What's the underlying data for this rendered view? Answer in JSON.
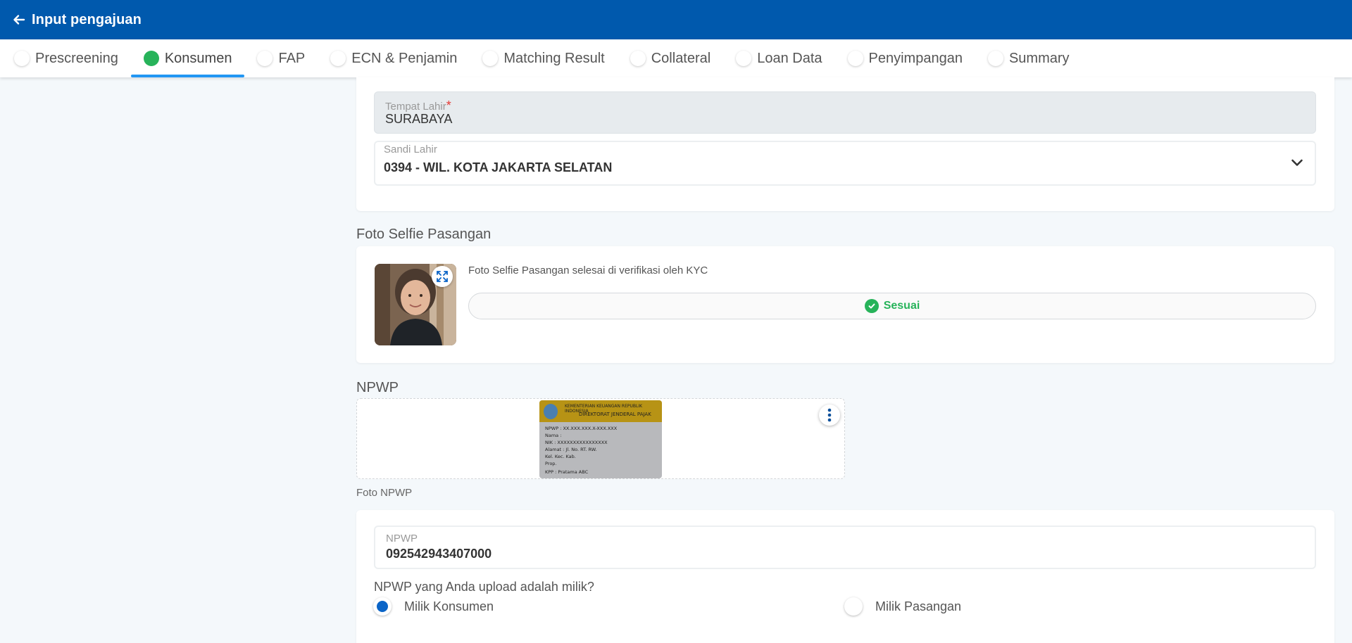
{
  "header": {
    "title": "Input pengajuan",
    "background": "#0059ad"
  },
  "tabs": [
    {
      "label": "Prescreening",
      "active": false
    },
    {
      "label": "Konsumen",
      "active": true
    },
    {
      "label": "FAP",
      "active": false
    },
    {
      "label": "ECN & Penjamin",
      "active": false
    },
    {
      "label": "Matching Result",
      "active": false
    },
    {
      "label": "Collateral",
      "active": false
    },
    {
      "label": "Loan Data",
      "active": false
    },
    {
      "label": "Penyimpangan",
      "active": false
    },
    {
      "label": "Summary",
      "active": false
    }
  ],
  "birth": {
    "tempat_lahir_label": "Tempat Lahir",
    "required_mark": "*",
    "tempat_lahir_value": "SURABAYA",
    "sandi_lahir_label": "Sandi Lahir",
    "sandi_lahir_value": "0394 - WIL. KOTA JAKARTA SELATAN"
  },
  "selfie": {
    "section_title": "Foto Selfie Pasangan",
    "caption": "Foto Selfie Pasangan selesai di verifikasi oleh KYC",
    "status": "Sesuai",
    "status_color": "#27b35a"
  },
  "npwp_upload": {
    "section_title": "NPWP",
    "caption": "Foto NPWP",
    "card": {
      "header_line1": "KEMENTERIAN KEUANGAN REPUBLIK INDONESIA",
      "header_line2": "DIREKTORAT JENDERAL PAJAK",
      "npwp": "NPWP :   XX.XXX.XXX.X-XXX.XXX",
      "nama": "Nama :",
      "nik": "NIK    : XXXXXXXXXXXXXXXX",
      "alamat": "Alamat : Jl.                No.      RT.   RW.",
      "kel": "Kel.                    Kec.               Kab.",
      "prop": "Prop.",
      "kpp": "KPP   : Pratama ABC"
    }
  },
  "npwp_form": {
    "npwp_label": "NPWP",
    "npwp_value": "092542943407000",
    "question": "NPWP yang Anda upload adalah milik?",
    "options": [
      {
        "label": "Milik Konsumen",
        "selected": true
      },
      {
        "label": "Milik Pasangan",
        "selected": false
      }
    ]
  }
}
